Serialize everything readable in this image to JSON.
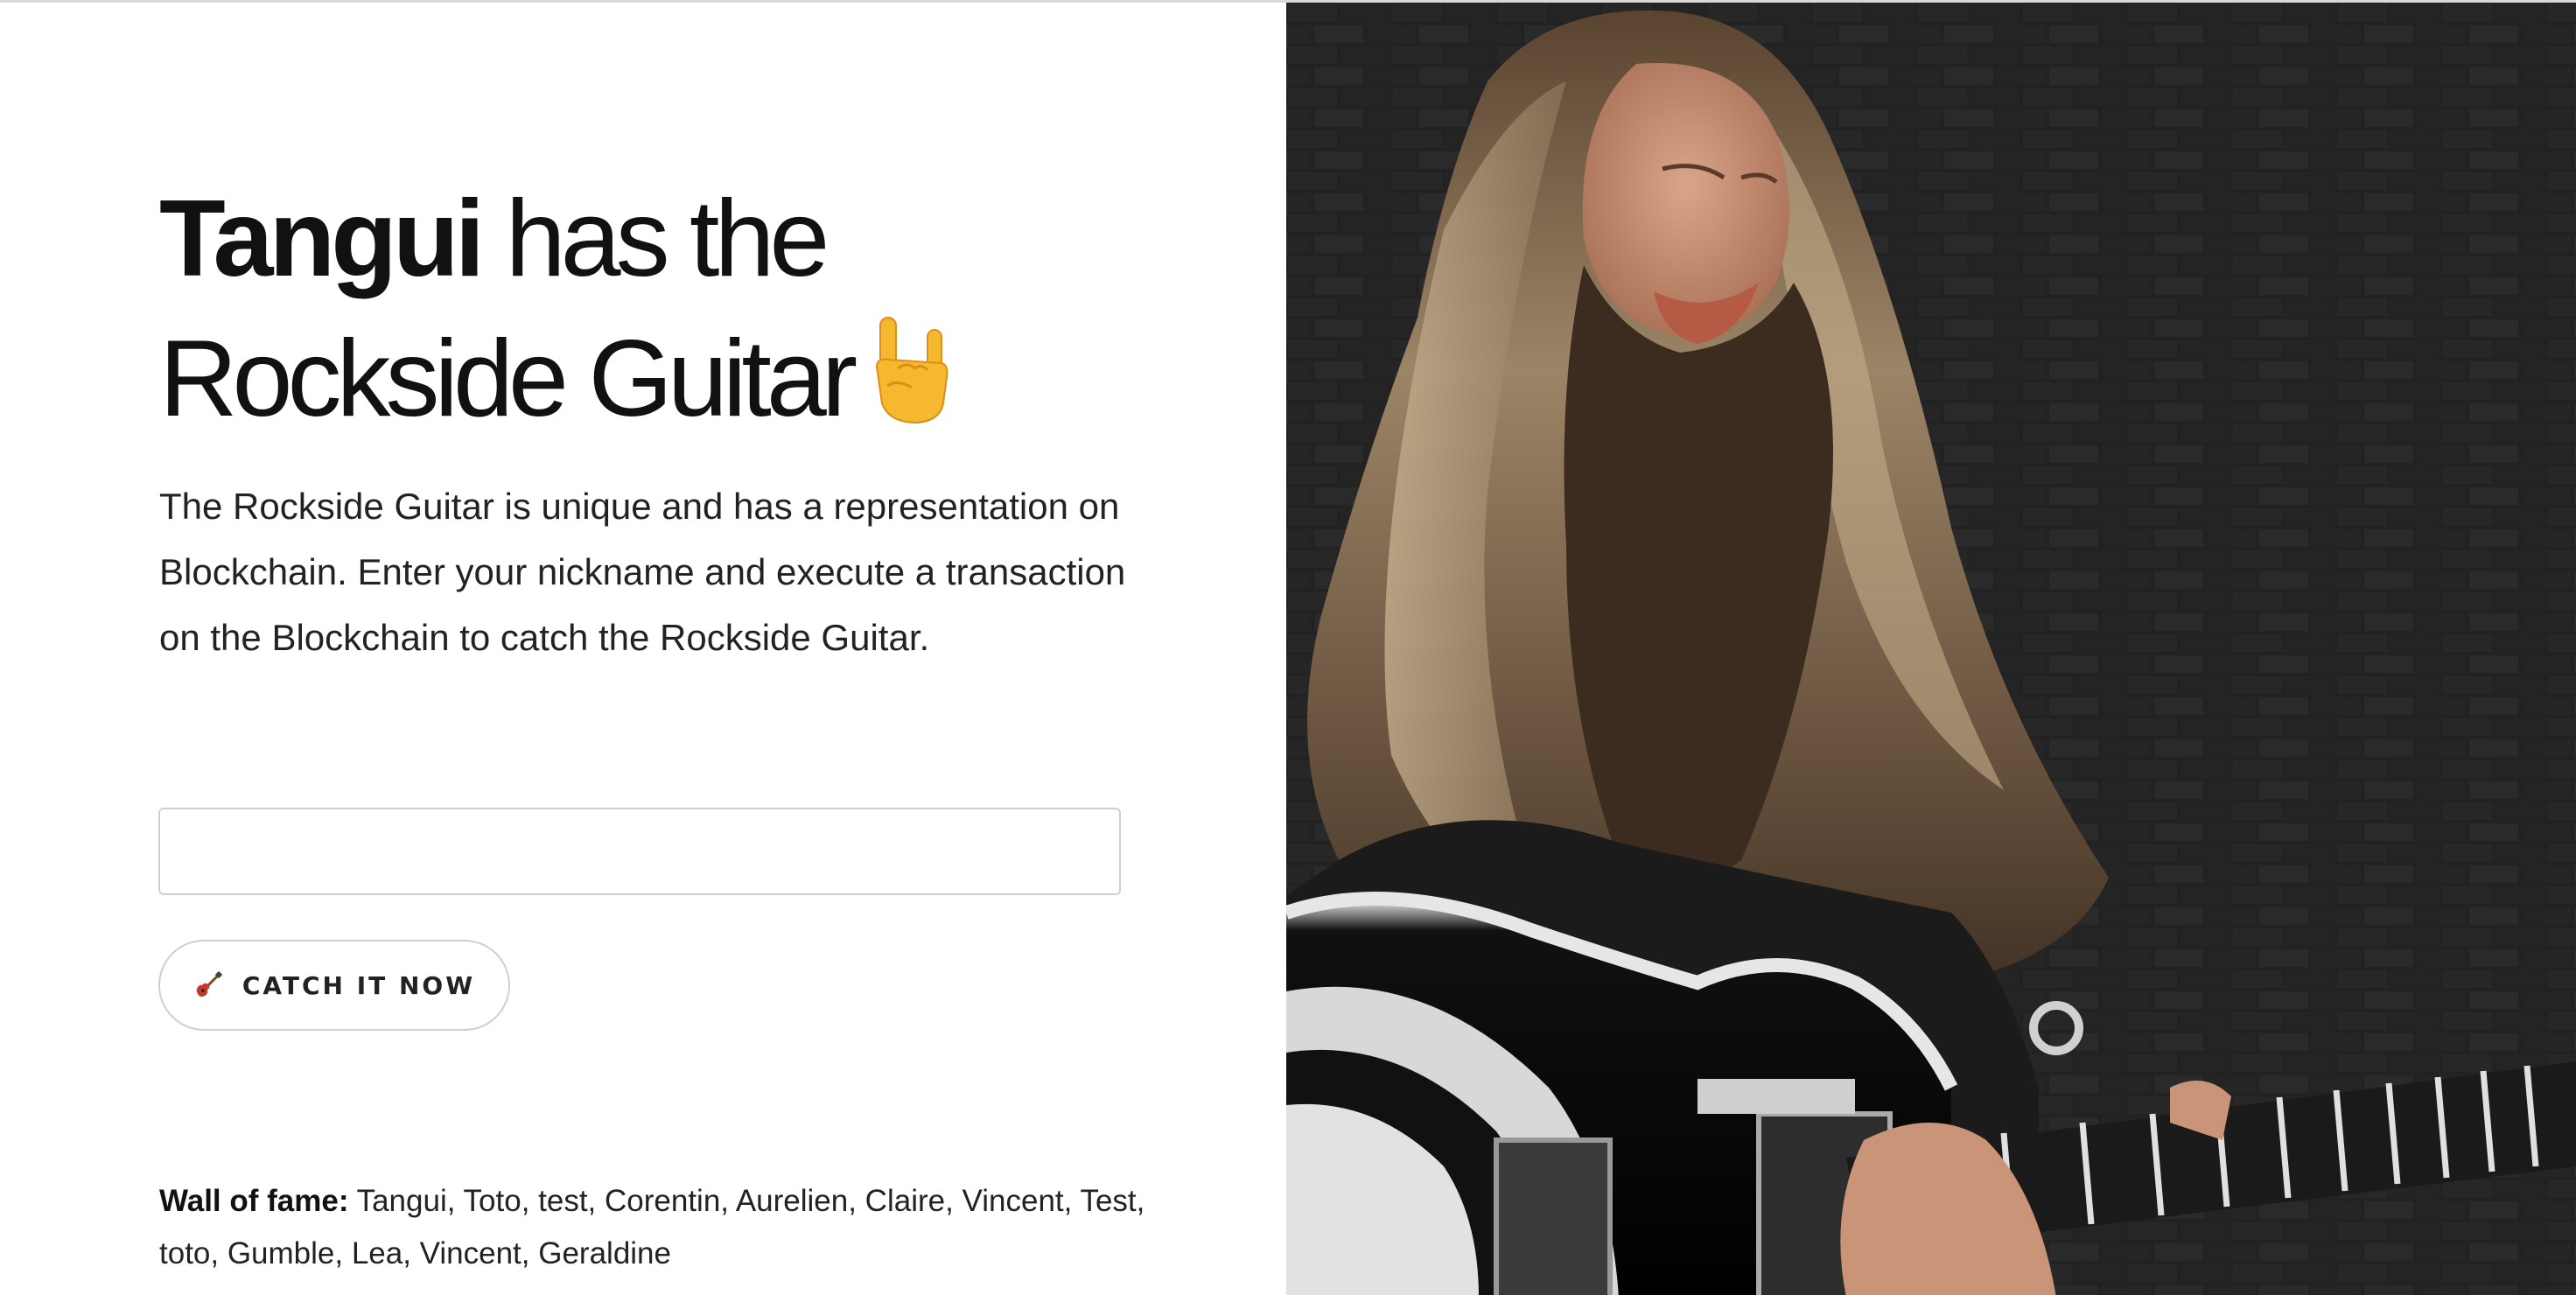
{
  "headline": {
    "winner": "Tangui",
    "line1_rest": " has the",
    "line2": "Rockside Guitar",
    "emoji": "sign-of-the-horns-emoji"
  },
  "description": "The Rockside Guitar is unique and has a representation on Blockchain. Enter your nickname and execute a transaction on the Blockchain to catch the Rockside Guitar.",
  "nickname_input": {
    "value": "",
    "placeholder": ""
  },
  "catch_button": {
    "icon": "guitar-icon",
    "label": "CATCH IT NOW"
  },
  "wall_of_fame": {
    "label": "Wall of fame:",
    "names": " Tangui, Toto, test, Corentin, Aurelien, Claire, Vincent, Test, toto, Gumble, Lea, Vincent, Geraldine"
  },
  "colors": {
    "text": "#111111",
    "border": "#cfcfcf",
    "guitar_red": "#c0392b",
    "emoji_yellow": "#f5b82e"
  }
}
